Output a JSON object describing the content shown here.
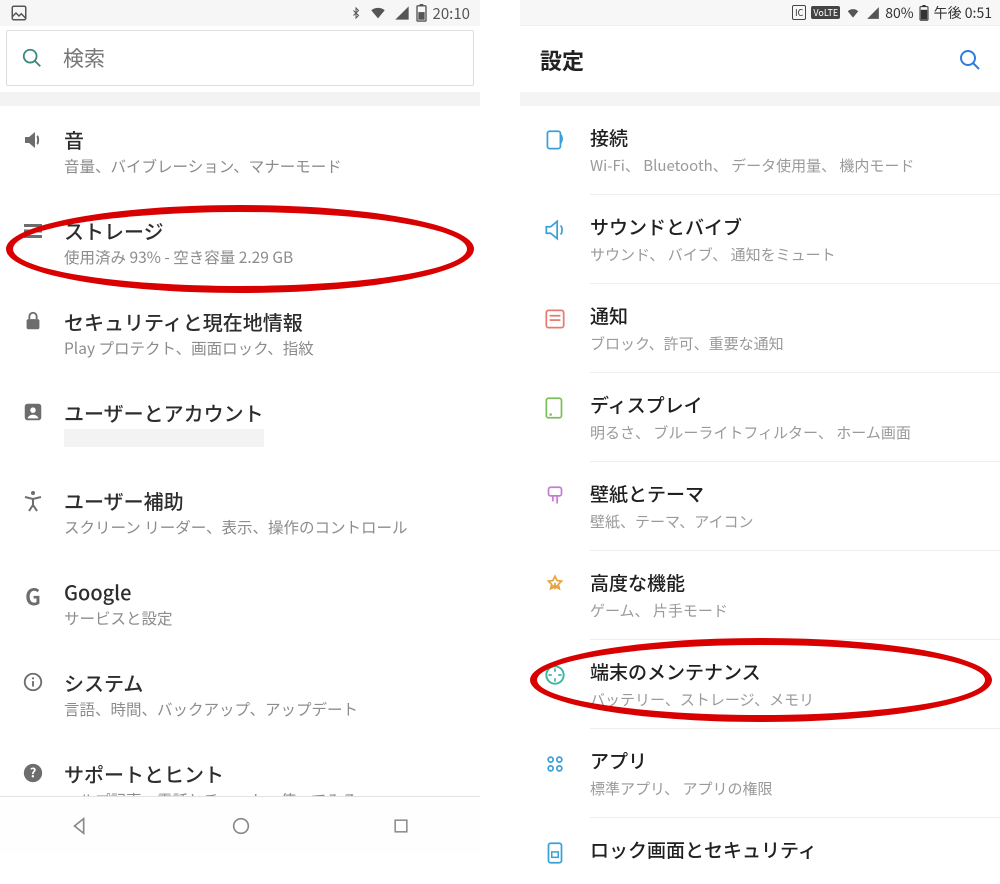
{
  "left": {
    "status": {
      "time": "20:10"
    },
    "search": {
      "placeholder": "検索"
    },
    "items": [
      {
        "title": "音",
        "sub": "音量、バイブレーション、マナーモード"
      },
      {
        "title": "ストレージ",
        "sub": "使用済み 93% - 空き容量 2.29 GB"
      },
      {
        "title": "セキュリティと現在地情報",
        "sub": "Play プロテクト、画面ロック、指紋"
      },
      {
        "title": "ユーザーとアカウント",
        "sub": ""
      },
      {
        "title": "ユーザー補助",
        "sub": "スクリーン リーダー、表示、操作のコントロール"
      },
      {
        "title": "Google",
        "sub": "サービスと設定"
      },
      {
        "title": "システム",
        "sub": "言語、時間、バックアップ、アップデート"
      },
      {
        "title": "サポートとヒント",
        "sub": "ヘルプ記事、電話とチャット、使ってみる"
      }
    ]
  },
  "right": {
    "status": {
      "battery": "80%",
      "time": "午後 0:51"
    },
    "header": {
      "title": "設定"
    },
    "items": [
      {
        "title": "接続",
        "sub": "Wi-Fi、 Bluetooth、 データ使用量、 機内モード"
      },
      {
        "title": "サウンドとバイブ",
        "sub": "サウンド、 バイブ、 通知をミュート"
      },
      {
        "title": "通知",
        "sub": "ブロック、許可、重要な通知"
      },
      {
        "title": "ディスプレイ",
        "sub": "明るさ、 ブルーライトフィルター、 ホーム画面"
      },
      {
        "title": "壁紙とテーマ",
        "sub": "壁紙、テーマ、アイコン"
      },
      {
        "title": "高度な機能",
        "sub": "ゲーム、 片手モード"
      },
      {
        "title": "端末のメンテナンス",
        "sub": "バッテリー、ストレージ、メモリ"
      },
      {
        "title": "アプリ",
        "sub": "標準アプリ、 アプリの権限"
      },
      {
        "title": "ロック画面とセキュリティ",
        "sub": ""
      }
    ]
  }
}
